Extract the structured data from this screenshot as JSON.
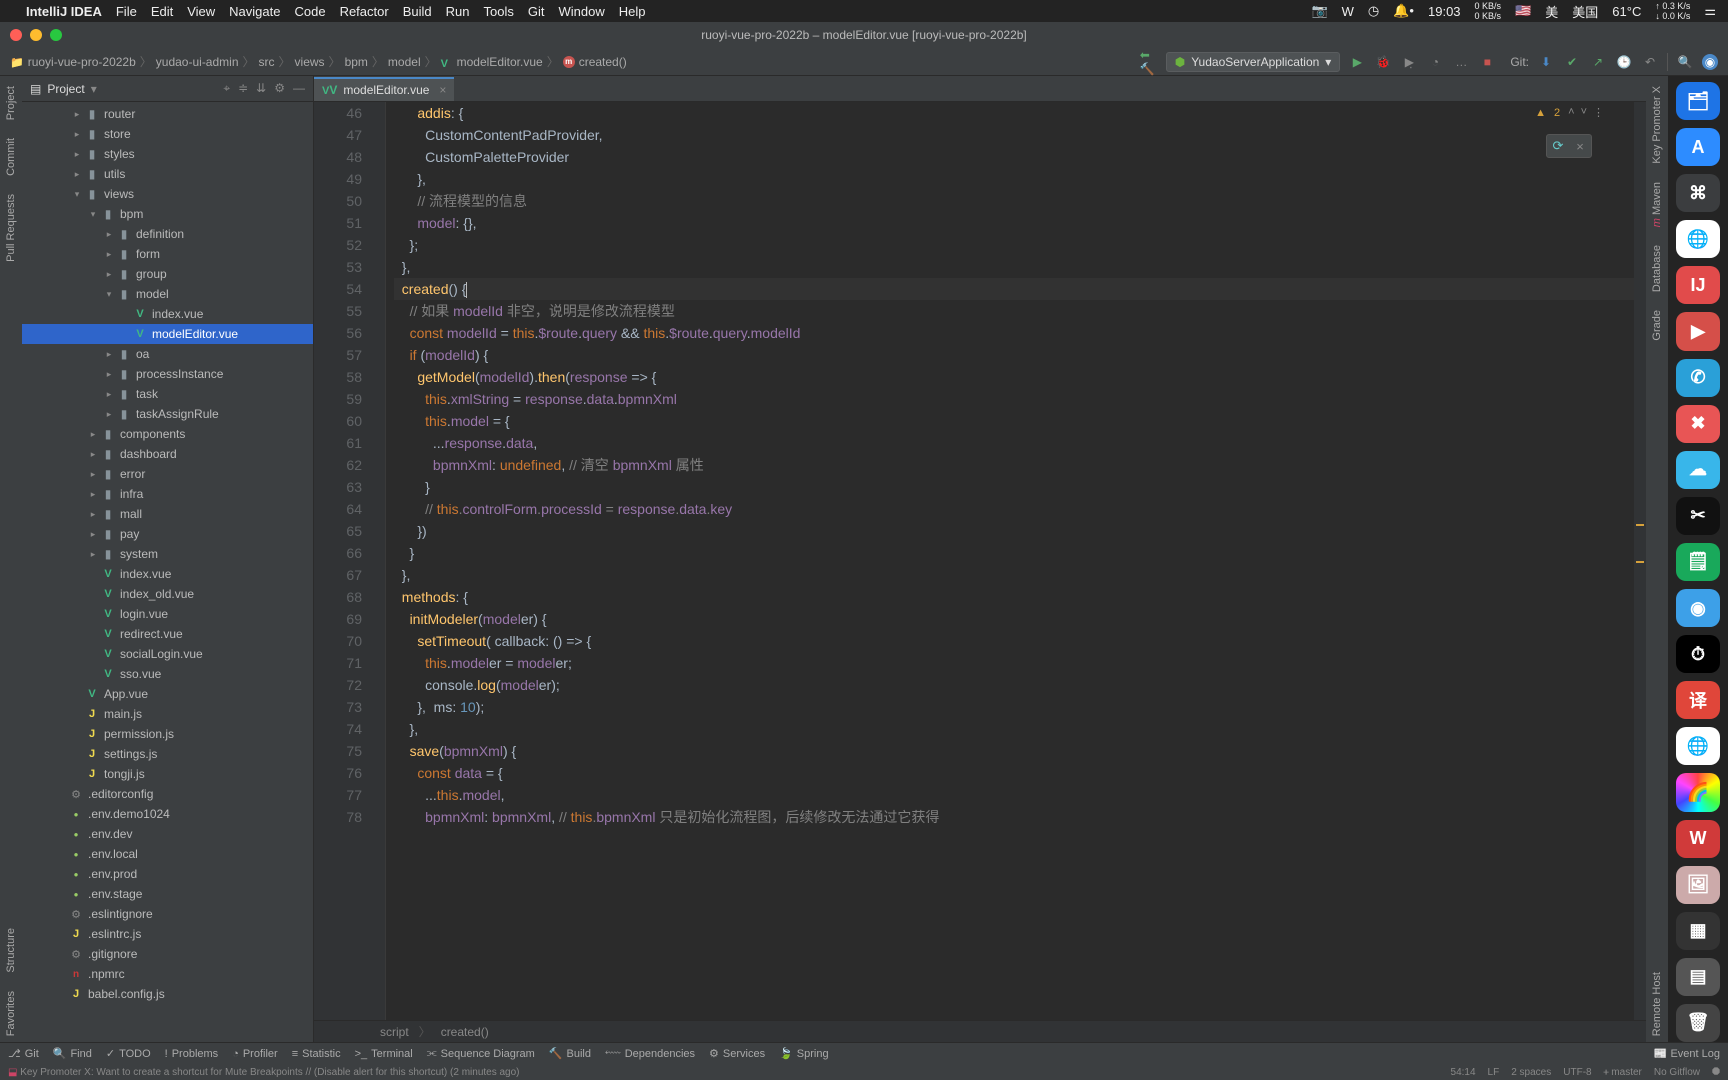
{
  "mac_menu": {
    "apple": "",
    "app": "IntelliJ IDEA",
    "items": [
      "File",
      "Edit",
      "View",
      "Navigate",
      "Code",
      "Refactor",
      "Build",
      "Run",
      "Tools",
      "Git",
      "Window",
      "Help"
    ],
    "right": {
      "time": "19:03",
      "net1_top": "0 KB/s",
      "net1_bot": "0 KB/s",
      "lang": "美",
      "lang2": "美国",
      "temp": "61°C",
      "cpu_top": "↑ 0.3 K/s",
      "cpu_bot": "↓ 0.0 K/s"
    }
  },
  "window": {
    "title": "ruoyi-vue-pro-2022b – modelEditor.vue [ruoyi-vue-pro-2022b]"
  },
  "breadcrumbs": [
    "ruoyi-vue-pro-2022b",
    "yudao-ui-admin",
    "src",
    "views",
    "bpm",
    "model",
    "modelEditor.vue",
    "created()"
  ],
  "run": {
    "config": "YudaoServerApplication",
    "vcs_label": "Git:"
  },
  "left_tabs": [
    "Project",
    "Commit",
    "Pull Requests",
    "Structure",
    "Favorites"
  ],
  "right_tabs": [
    "Key Promoter X",
    "Maven",
    "Database",
    "Grade",
    "Remote Host"
  ],
  "project": {
    "title": "Project",
    "tree": [
      {
        "d": 3,
        "i": "folder",
        "l": "router",
        "e": true
      },
      {
        "d": 3,
        "i": "folder",
        "l": "store",
        "e": true
      },
      {
        "d": 3,
        "i": "folder",
        "l": "styles",
        "e": true
      },
      {
        "d": 3,
        "i": "folder",
        "l": "utils",
        "e": true
      },
      {
        "d": 3,
        "i": "folder",
        "l": "views",
        "e": true,
        "o": true
      },
      {
        "d": 4,
        "i": "folder",
        "l": "bpm",
        "e": true,
        "o": true
      },
      {
        "d": 5,
        "i": "folder",
        "l": "definition",
        "e": true
      },
      {
        "d": 5,
        "i": "folder",
        "l": "form",
        "e": true
      },
      {
        "d": 5,
        "i": "folder",
        "l": "group",
        "e": true
      },
      {
        "d": 5,
        "i": "folder",
        "l": "model",
        "e": true,
        "o": true
      },
      {
        "d": 6,
        "i": "vue",
        "l": "index.vue"
      },
      {
        "d": 6,
        "i": "vue",
        "l": "modelEditor.vue",
        "sel": true
      },
      {
        "d": 5,
        "i": "folder",
        "l": "oa",
        "e": true
      },
      {
        "d": 5,
        "i": "folder",
        "l": "processInstance",
        "e": true
      },
      {
        "d": 5,
        "i": "folder",
        "l": "task",
        "e": true
      },
      {
        "d": 5,
        "i": "folder",
        "l": "taskAssignRule",
        "e": true
      },
      {
        "d": 4,
        "i": "folder",
        "l": "components",
        "e": true
      },
      {
        "d": 4,
        "i": "folder",
        "l": "dashboard",
        "e": true
      },
      {
        "d": 4,
        "i": "folder",
        "l": "error",
        "e": true
      },
      {
        "d": 4,
        "i": "folder",
        "l": "infra",
        "e": true
      },
      {
        "d": 4,
        "i": "folder",
        "l": "mall",
        "e": true
      },
      {
        "d": 4,
        "i": "folder",
        "l": "pay",
        "e": true
      },
      {
        "d": 4,
        "i": "folder",
        "l": "system",
        "e": true
      },
      {
        "d": 4,
        "i": "vue",
        "l": "index.vue"
      },
      {
        "d": 4,
        "i": "vue",
        "l": "index_old.vue"
      },
      {
        "d": 4,
        "i": "vue",
        "l": "login.vue"
      },
      {
        "d": 4,
        "i": "vue",
        "l": "redirect.vue"
      },
      {
        "d": 4,
        "i": "vue",
        "l": "socialLogin.vue"
      },
      {
        "d": 4,
        "i": "vue",
        "l": "sso.vue"
      },
      {
        "d": 3,
        "i": "vue",
        "l": "App.vue"
      },
      {
        "d": 3,
        "i": "js",
        "l": "main.js"
      },
      {
        "d": 3,
        "i": "js",
        "l": "permission.js"
      },
      {
        "d": 3,
        "i": "js",
        "l": "settings.js"
      },
      {
        "d": 3,
        "i": "js",
        "l": "tongji.js"
      },
      {
        "d": 2,
        "i": "cfg",
        "l": ".editorconfig"
      },
      {
        "d": 2,
        "i": "env",
        "l": ".env.demo1024"
      },
      {
        "d": 2,
        "i": "env",
        "l": ".env.dev"
      },
      {
        "d": 2,
        "i": "env",
        "l": ".env.local"
      },
      {
        "d": 2,
        "i": "env",
        "l": ".env.prod"
      },
      {
        "d": 2,
        "i": "env",
        "l": ".env.stage"
      },
      {
        "d": 2,
        "i": "cfg",
        "l": ".eslintignore"
      },
      {
        "d": 2,
        "i": "js",
        "l": ".eslintrc.js"
      },
      {
        "d": 2,
        "i": "cfg",
        "l": ".gitignore"
      },
      {
        "d": 2,
        "i": "npm",
        "l": ".npmrc"
      },
      {
        "d": 2,
        "i": "js",
        "l": "babel.config.js"
      }
    ]
  },
  "editor": {
    "tab_file": "modelEditor.vue",
    "first_line": 46,
    "warnings": "2",
    "breadcrumb": [
      "script",
      "created()"
    ],
    "lines": [
      "      addis: {",
      "        CustomContentPadProvider,",
      "        CustomPaletteProvider",
      "      },",
      "      // 流程模型的信息",
      "      model: {},",
      "    };",
      "  },",
      "  created() {",
      "    // 如果 modelId 非空，说明是修改流程模型",
      "    const modelId = this.$route.query && this.$route.query.modelId",
      "    if (modelId) {",
      "      getModel(modelId).then(response => {",
      "        this.xmlString = response.data.bpmnXml",
      "        this.model = {",
      "          ...response.data,",
      "          bpmnXml: undefined, // 清空 bpmnXml 属性",
      "        }",
      "        // this.controlForm.processId = response.data.key",
      "      })",
      "    }",
      "  },",
      "  methods: {",
      "    initModeler(modeler) {",
      "      setTimeout( callback: () => {",
      "        this.modeler = modeler;",
      "        console.log(modeler);",
      "      },  ms: 10);",
      "    },",
      "    save(bpmnXml) {",
      "      const data = {",
      "        ...this.model,",
      "        bpmnXml: bpmnXml, // this.bpmnXml 只是初始化流程图，后续修改无法通过它获得"
    ]
  },
  "bottom_tools": [
    "Git",
    "Find",
    "TODO",
    "Problems",
    "Profiler",
    "Statistic",
    "Terminal",
    "Sequence Diagram",
    "Build",
    "Dependencies",
    "Services",
    "Spring"
  ],
  "bottom_right": "Event Log",
  "status": {
    "left": "Key Promoter X: Want to create a shortcut for Mute Breakpoints // (Disable alert for this shortcut) (2 minutes ago)",
    "right": [
      "54:14",
      "LF",
      "2 spaces",
      "UTF-8",
      "ᚐ master",
      "No Gitflow",
      "⯃"
    ]
  },
  "dock_apps": [
    {
      "bg": "#1e74e6",
      "t": "🗂"
    },
    {
      "bg": "#2d8cff",
      "t": "A"
    },
    {
      "bg": "#3b3d3f",
      "t": "⌘"
    },
    {
      "bg": "#fff",
      "t": "🌐"
    },
    {
      "bg": "#e14b4b",
      "t": "IJ"
    },
    {
      "bg": "#d54f49",
      "t": "▶"
    },
    {
      "bg": "#2aa0d8",
      "t": "✆"
    },
    {
      "bg": "#e85555",
      "t": "✖"
    },
    {
      "bg": "#38b6ea",
      "t": "☁"
    },
    {
      "bg": "#111",
      "t": "✂"
    },
    {
      "bg": "#19a95b",
      "t": "🗒"
    },
    {
      "bg": "#3da0e8",
      "t": "◉"
    },
    {
      "bg": "#000",
      "t": "⏱"
    },
    {
      "bg": "#e0463a",
      "t": "译"
    },
    {
      "bg": "#fff",
      "t": "🌐"
    },
    {
      "bg": "linear",
      "t": "🌈"
    },
    {
      "bg": "#d03a3a",
      "t": "W"
    },
    {
      "bg": "#caa",
      "t": "🖼"
    },
    {
      "bg": "#333",
      "t": "▦"
    },
    {
      "bg": "#555",
      "t": "▤"
    },
    {
      "bg": "#444",
      "t": "🗑"
    }
  ]
}
